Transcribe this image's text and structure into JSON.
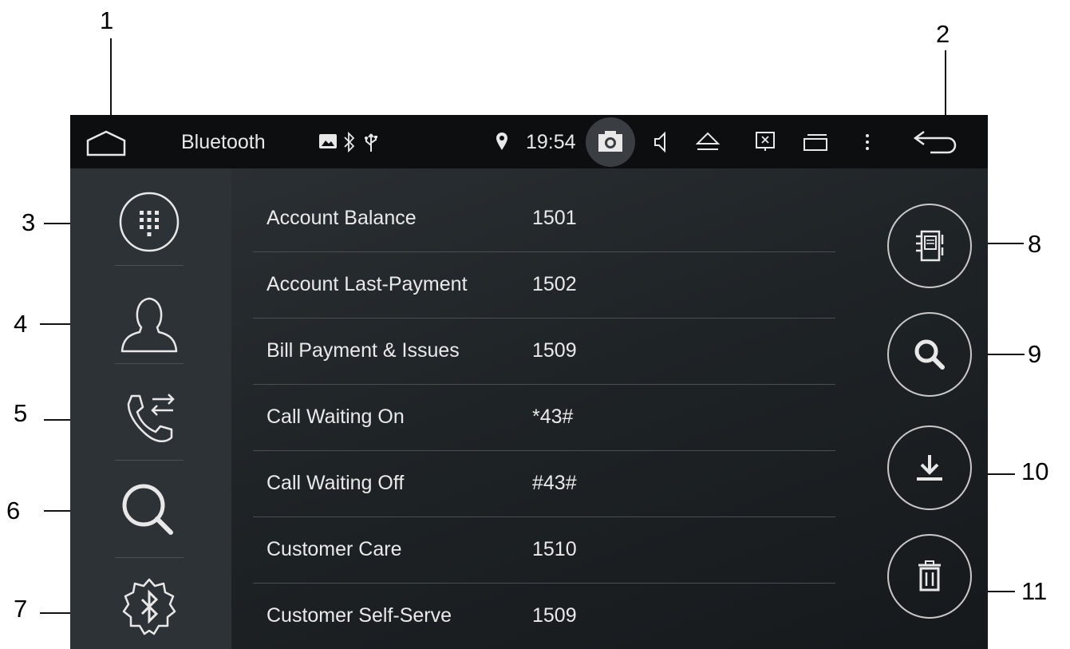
{
  "callouts": [
    "1",
    "2",
    "3",
    "4",
    "5",
    "6",
    "7",
    "8",
    "9",
    "10",
    "11"
  ],
  "status_bar": {
    "title": "Bluetooth",
    "time": "19:54",
    "icons": [
      "home-icon",
      "image-icon",
      "bluetooth-icon",
      "usb-icon",
      "location-icon",
      "camera-icon",
      "volume-icon",
      "eject-icon",
      "screen-off-icon",
      "multitask-icon",
      "more-icon",
      "back-icon"
    ]
  },
  "sidebar": {
    "items": [
      {
        "name": "dialpad-icon"
      },
      {
        "name": "contacts-icon"
      },
      {
        "name": "call-log-icon"
      },
      {
        "name": "search-icon"
      },
      {
        "name": "bluetooth-settings-icon"
      }
    ]
  },
  "contacts": [
    {
      "name": "Account Balance",
      "number": "1501"
    },
    {
      "name": "Account Last-Payment",
      "number": "1502"
    },
    {
      "name": "Bill Payment & Issues",
      "number": "1509"
    },
    {
      "name": "Call Waiting On",
      "number": "*43#"
    },
    {
      "name": "Call Waiting Off",
      "number": "#43#"
    },
    {
      "name": "Customer Care",
      "number": "1510"
    },
    {
      "name": "Customer Self-Serve",
      "number": "1509"
    }
  ],
  "actions": [
    "sync-phonebook-icon",
    "search-icon",
    "download-icon",
    "delete-icon"
  ],
  "colors": {
    "statusbar": "#0c0e10",
    "sidebar": "#2d3236",
    "main": "#1e2326",
    "text": "#eaeaea",
    "outline": "#c9c9c9"
  }
}
